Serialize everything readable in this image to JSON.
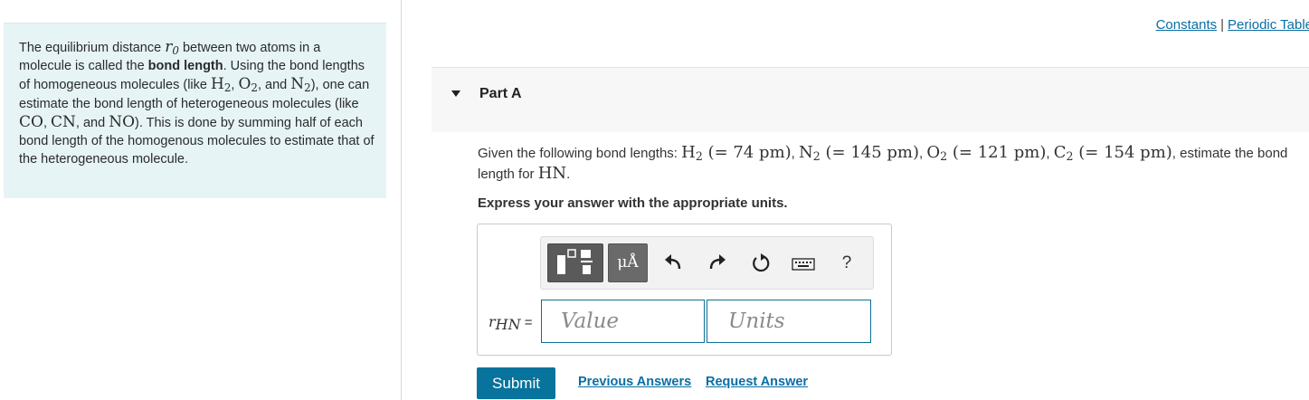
{
  "header": {
    "constants_link": "Constants",
    "separator": "|",
    "periodic_table_link": "Periodic Table"
  },
  "intro": {
    "t1": "The equilibrium distance ",
    "r0": "r",
    "r0_sub": "0",
    "t2": " between two atoms in a molecule is called the ",
    "bond_length": "bond length",
    "t3": ". Using the bond lengths of homogeneous molecules (like ",
    "h2": "H",
    "h2_sub": "2",
    "c1": ", ",
    "o2": "O",
    "o2_sub": "2",
    "c2": ", and ",
    "n2": "N",
    "n2_sub": "2",
    "t4": "), one can estimate the bond length of heterogeneous molecules (like ",
    "co": "CO",
    "c3": ", ",
    "cn": "CN",
    "c4": ", and ",
    "no": "NO",
    "t5": "). This is done by summing half of each bond length of the homogenous molecules to estimate that of the heterogeneous molecule."
  },
  "part": {
    "title": "Part A"
  },
  "question": {
    "prefix": "Given the following bond lengths: ",
    "b1": "H",
    "b1_sub": "2",
    "b1_val": " (= 74 pm)",
    "s1": ", ",
    "b2": "N",
    "b2_sub": "2",
    "b2_val": " (= 145 pm)",
    "s2": ", ",
    "b3": "O",
    "b3_sub": "2",
    "b3_val": " (= 121 pm)",
    "s3": ", ",
    "b4": "C",
    "b4_sub": "2",
    "b4_val": " (= 154 pm)",
    "suffix": ", estimate the bond length for ",
    "target": "HN",
    "end": "."
  },
  "instruction": "Express your answer with the appropriate units.",
  "toolbar": {
    "units_label": "μÅ",
    "help_label": "?",
    "icons": [
      "templates-icon",
      "units-icon",
      "undo-icon",
      "redo-icon",
      "reset-icon",
      "keyboard-icon",
      "help-icon"
    ]
  },
  "answer": {
    "var_r": "r",
    "var_sub": "HN",
    "equals": " =",
    "value_placeholder": "Value",
    "value": "",
    "units_placeholder": "Units",
    "units": ""
  },
  "actions": {
    "submit": "Submit",
    "previous_answers": "Previous Answers",
    "request_answer": "Request Answer"
  },
  "colors": {
    "accent": "#08739c",
    "link": "#0a6ea4",
    "intro_bg": "#e6f4f6"
  }
}
